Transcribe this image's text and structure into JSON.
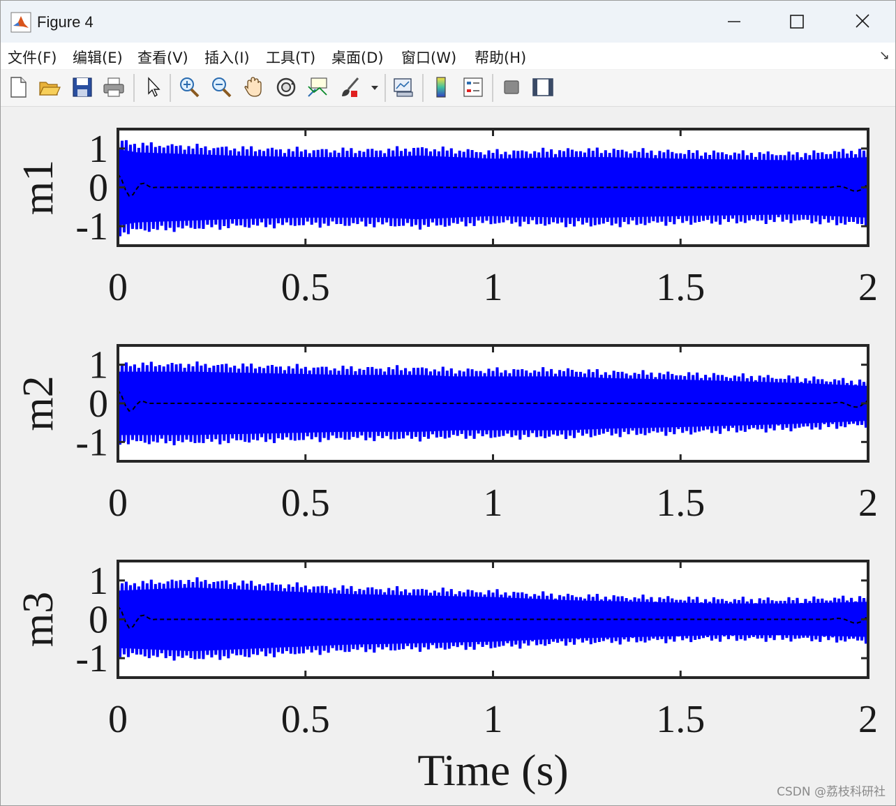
{
  "window": {
    "title": "Figure 4"
  },
  "menu": {
    "items": [
      "文件(F)",
      "编辑(E)",
      "查看(V)",
      "插入(I)",
      "工具(T)",
      "桌面(D)",
      "窗口(W)",
      "帮助(H)"
    ],
    "dock_arrow": "↘"
  },
  "toolbar": {
    "buttons": [
      "new-figure-icon",
      "open-file-icon",
      "save-icon",
      "print-icon",
      "pointer-icon",
      "zoom-in-icon",
      "zoom-out-icon",
      "pan-hand-icon",
      "rotate-3d-icon",
      "data-cursor-icon",
      "brush-icon",
      "link-plot-icon",
      "colorbar-icon",
      "legend-icon",
      "hide-plot-tools-icon",
      "show-plot-tools-icon"
    ]
  },
  "colors": {
    "signal": "#0000ff",
    "envelope": "#000000",
    "axes": "#262626"
  },
  "chart_data": [
    {
      "type": "line",
      "ylabel": "m1",
      "xlim": [
        0,
        2
      ],
      "ylim": [
        -1.5,
        1.5
      ],
      "x_ticks": [
        "0",
        "0.5",
        "1",
        "1.5",
        "2"
      ],
      "y_ticks": [
        "1",
        "0",
        "-1"
      ],
      "series": [
        {
          "style": "solid",
          "color": "#0000ff",
          "amplitude_envelope": {
            "x": [
              0,
              0.05,
              0.3,
              0.5,
              0.7,
              0.8,
              0.9,
              1.0,
              1.2,
              1.3,
              1.5,
              1.8,
              2.0
            ],
            "y": [
              1.2,
              1.1,
              1.0,
              0.95,
              0.95,
              1.0,
              0.95,
              0.9,
              0.95,
              0.95,
              0.9,
              0.85,
              0.95
            ]
          }
        },
        {
          "style": "dashed",
          "color": "#000000",
          "transient_x": [
            0,
            0.1
          ],
          "steady_y": 0
        }
      ]
    },
    {
      "type": "line",
      "ylabel": "m2",
      "xlim": [
        0,
        2
      ],
      "ylim": [
        -1.5,
        1.5
      ],
      "x_ticks": [
        "0",
        "0.5",
        "1",
        "1.5",
        "2"
      ],
      "y_ticks": [
        "1",
        "0",
        "-1"
      ],
      "series": [
        {
          "style": "solid",
          "color": "#0000ff",
          "amplitude_envelope": {
            "x": [
              0,
              0.2,
              0.4,
              0.6,
              0.8,
              0.9,
              1.0,
              1.1,
              1.2,
              1.3,
              1.5,
              1.8,
              2.0
            ],
            "y": [
              1.0,
              1.0,
              0.95,
              0.9,
              0.9,
              0.85,
              0.85,
              0.85,
              0.85,
              0.8,
              0.75,
              0.65,
              0.55
            ]
          }
        },
        {
          "style": "dashed",
          "color": "#000000",
          "transient_x": [
            0,
            0.08
          ],
          "steady_y": 0
        }
      ]
    },
    {
      "type": "line",
      "ylabel": "m3",
      "xlim": [
        0,
        2
      ],
      "ylim": [
        -1.5,
        1.5
      ],
      "x_ticks": [
        "0",
        "0.5",
        "1",
        "1.5",
        "2"
      ],
      "y_ticks": [
        "1",
        "0",
        "-1"
      ],
      "series": [
        {
          "style": "solid",
          "color": "#0000ff",
          "amplitude_envelope": {
            "x": [
              0,
              0.2,
              0.4,
              0.6,
              0.8,
              1.0,
              1.2,
              1.4,
              1.6,
              1.8,
              2.0
            ],
            "y": [
              0.9,
              1.0,
              0.9,
              0.8,
              0.75,
              0.7,
              0.6,
              0.55,
              0.5,
              0.5,
              0.55
            ]
          }
        },
        {
          "style": "dashed",
          "color": "#000000",
          "transient_x": [
            0,
            0.1
          ],
          "steady_y": 0
        }
      ]
    }
  ],
  "xlabel": "Time (s)",
  "watermark": "CSDN @荔枝科研社"
}
